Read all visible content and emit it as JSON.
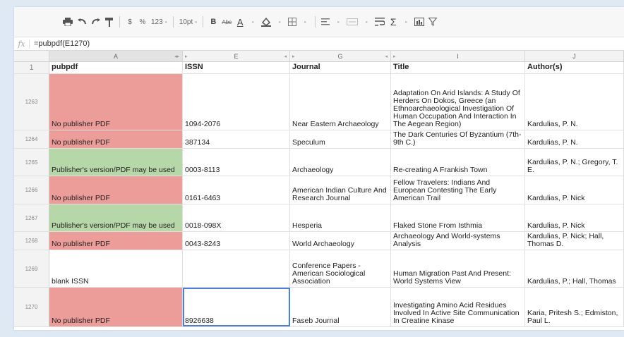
{
  "toolbar": {
    "items": [
      "print-icon",
      "undo-icon",
      "redo-icon",
      "paint-format-icon",
      "currency-icon",
      "percent-icon",
      "number-format",
      "font-size",
      "bold-icon",
      "strikethrough-icon",
      "text-color-icon",
      "fill-color-icon",
      "borders-icon",
      "align-icon",
      "merge-icon",
      "wrap-icon",
      "functions-icon",
      "chart-icon",
      "filter-icon"
    ],
    "dollar": "$",
    "percent": "%",
    "number_format": "123 -",
    "font_size": "10pt -",
    "bold": "B",
    "strike": "Abc",
    "text_color": "A",
    "dash": "-",
    "sigma": "Σ"
  },
  "formula_bar": {
    "fx": "fx",
    "value": "=pubpdf(E1270)"
  },
  "columns": [
    "A",
    "E",
    "G",
    "I",
    "J"
  ],
  "header": {
    "row_number": "1",
    "cells": [
      "pubpdf",
      "ISSN",
      "Journal",
      "Title",
      "Author(s)"
    ]
  },
  "rows": [
    {
      "num": "1263",
      "status": "red",
      "a": "No publisher PDF",
      "e": "1094-2076",
      "g": "Near Eastern Archaeology",
      "i": "Adaptation On Arid Islands: A Study Of Herders On Dokos, Greece (an Ethnoarchaeological Investigation Of Human Occupation And Interaction In The Aegean Region)",
      "j": "Kardulias, P. N."
    },
    {
      "num": "1264",
      "status": "red",
      "a": "No publisher PDF",
      "e": "387134",
      "g": "Speculum",
      "i": "The Dark Centuries Of Byzantium (7th-9th C.)",
      "j": "Kardulias, P. N."
    },
    {
      "num": "1265",
      "status": "green",
      "a": "Publisher's version/PDF may be used",
      "e": "0003-8113",
      "g": "Archaeology",
      "i": "Re-creating A Frankish Town",
      "j": "Kardulias, P. N.; Gregory, T. E."
    },
    {
      "num": "1266",
      "status": "red",
      "a": "No publisher PDF",
      "e": "0161-6463",
      "g": "American Indian Culture And Research Journal",
      "i": "Fellow Travelers: Indians And European Contesting The Early American Trail",
      "j": "Kardulias, P. Nick"
    },
    {
      "num": "1267",
      "status": "green",
      "a": "Publisher's version/PDF may be used",
      "e": "0018-098X",
      "g": "Hesperia",
      "i": "Flaked Stone From Isthmia",
      "j": "Kardulias, P. Nick"
    },
    {
      "num": "1268",
      "status": "red",
      "a": "No publisher PDF",
      "e": "0043-8243",
      "g": "World Archaeology",
      "i": "Archaeology And World-systems Analysis",
      "j": "Kardulias, P. Nick; Hall, Thomas D."
    },
    {
      "num": "1269",
      "status": "none",
      "a": "blank ISSN",
      "e": "",
      "g": "Conference Papers - American Sociological Association",
      "i": "Human Migration Past And Present: World Systems View",
      "j": "Kardulias, P.; Hall, Thomas"
    },
    {
      "num": "1270",
      "status": "red",
      "a": "No publisher PDF",
      "e": "8926638",
      "g": "Faseb Journal",
      "i": "Investigating Amino Acid Residues Involved In Active Site Communication In Creatine Kinase",
      "j": "Karia, Pritesh S.; Edmiston, Paul L."
    }
  ],
  "colors": {
    "red": "#ec9c99",
    "green": "#b6d7a8",
    "selection": "#4a7ee0"
  }
}
